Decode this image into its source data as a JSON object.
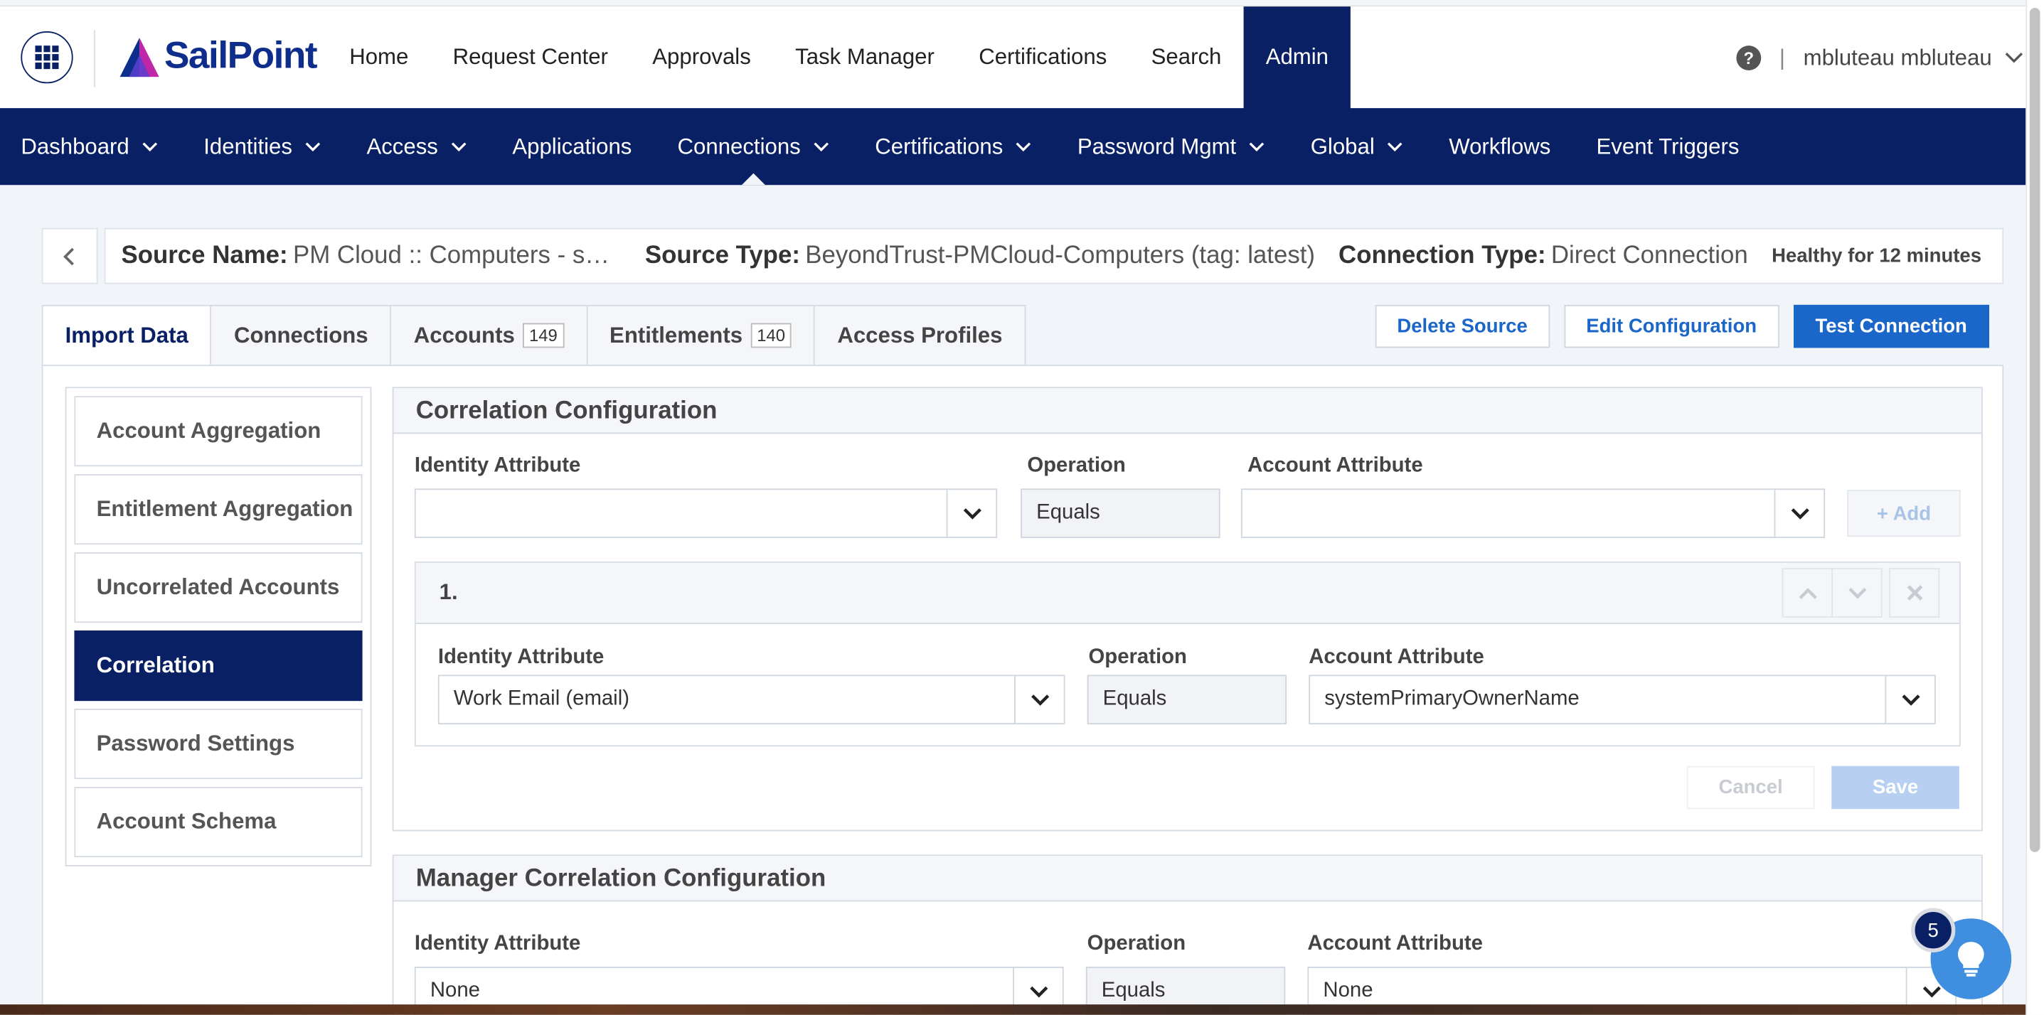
{
  "topnav": {
    "logo_text": "SailPoint",
    "items": [
      "Home",
      "Request Center",
      "Approvals",
      "Task Manager",
      "Certifications",
      "Search",
      "Admin"
    ],
    "active": "Admin",
    "help_glyph": "?",
    "separator": "|",
    "user": "mbluteau mbluteau"
  },
  "subnav": {
    "items": [
      {
        "label": "Dashboard",
        "dropdown": true
      },
      {
        "label": "Identities",
        "dropdown": true
      },
      {
        "label": "Access",
        "dropdown": true
      },
      {
        "label": "Applications",
        "dropdown": false
      },
      {
        "label": "Connections",
        "dropdown": true
      },
      {
        "label": "Certifications",
        "dropdown": true
      },
      {
        "label": "Password Mgmt",
        "dropdown": true
      },
      {
        "label": "Global",
        "dropdown": true
      },
      {
        "label": "Workflows",
        "dropdown": false
      },
      {
        "label": "Event Triggers",
        "dropdown": false
      }
    ],
    "active": "Connections"
  },
  "source": {
    "name_label": "Source Name:",
    "name": "PM Cloud :: Computers - sn…",
    "type_label": "Source Type:",
    "type": "BeyondTrust-PMCloud-Computers (tag: latest)",
    "conn_label": "Connection Type:",
    "conn": "Direct Connection",
    "health": "Healthy for 12 minutes"
  },
  "tabs": [
    {
      "label": "Import Data",
      "count": ""
    },
    {
      "label": "Connections",
      "count": ""
    },
    {
      "label": "Accounts",
      "count": "149"
    },
    {
      "label": "Entitlements",
      "count": "140"
    },
    {
      "label": "Access Profiles",
      "count": ""
    }
  ],
  "actions": {
    "delete": "Delete Source",
    "edit": "Edit Configuration",
    "test": "Test Connection"
  },
  "leftnav": [
    "Account Aggregation",
    "Entitlement Aggregation",
    "Uncorrelated Accounts",
    "Correlation",
    "Password Settings",
    "Account Schema"
  ],
  "leftnav_selected": "Correlation",
  "correlation": {
    "title": "Correlation Configuration",
    "identity_label": "Identity Attribute",
    "operation_label": "Operation",
    "account_label": "Account Attribute",
    "new_identity": "",
    "new_operation": "Equals",
    "new_account": "",
    "add_label": "+ Add",
    "rule": {
      "number": "1.",
      "identity": "Work Email (email)",
      "operation": "Equals",
      "account": "systemPrimaryOwnerName"
    },
    "cancel": "Cancel",
    "save": "Save"
  },
  "manager": {
    "title": "Manager Correlation Configuration",
    "identity_label": "Identity Attribute",
    "operation_label": "Operation",
    "account_label": "Account Attribute",
    "identity": "None",
    "operation": "Equals",
    "account": "None"
  },
  "help_badge": "5",
  "colors": {
    "navy": "#0a2064",
    "primary": "#1b66c9",
    "bg": "#f1f4f8"
  }
}
